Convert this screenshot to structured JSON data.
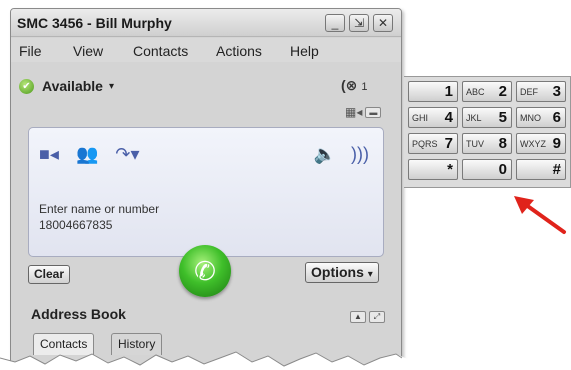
{
  "window": {
    "title": "SMC 3456 - Bill Murphy",
    "controls": {
      "minimize": "_",
      "restore": "⇲",
      "close": "✕"
    }
  },
  "menu": [
    "File",
    "View",
    "Contacts",
    "Actions",
    "Help"
  ],
  "status": {
    "label": "Available",
    "caret": "▾",
    "icon": "available-check-icon"
  },
  "missed_calls": {
    "icon": "missed-call-icon",
    "count": "1"
  },
  "call_panel": {
    "entry_label": "Enter name or number",
    "entry_value": "18004667835"
  },
  "buttons": {
    "clear": "Clear",
    "options": "Options",
    "options_caret": "▾"
  },
  "address_book": {
    "title": "Address Book",
    "tabs": [
      "Contacts",
      "History"
    ]
  },
  "keypad": [
    {
      "letters": "",
      "digit": "1"
    },
    {
      "letters": "ABC",
      "digit": "2"
    },
    {
      "letters": "DEF",
      "digit": "3"
    },
    {
      "letters": "GHI",
      "digit": "4"
    },
    {
      "letters": "JKL",
      "digit": "5"
    },
    {
      "letters": "MNO",
      "digit": "6"
    },
    {
      "letters": "PQRS",
      "digit": "7"
    },
    {
      "letters": "TUV",
      "digit": "8"
    },
    {
      "letters": "WXYZ",
      "digit": "9"
    },
    {
      "letters": "",
      "digit": "*"
    },
    {
      "letters": "",
      "digit": "0"
    },
    {
      "letters": "",
      "digit": "#"
    }
  ],
  "colors": {
    "call_button": "#3fbf2a",
    "accent_icons": "#4a5fa8",
    "annotation_arrow": "#e0231b"
  }
}
